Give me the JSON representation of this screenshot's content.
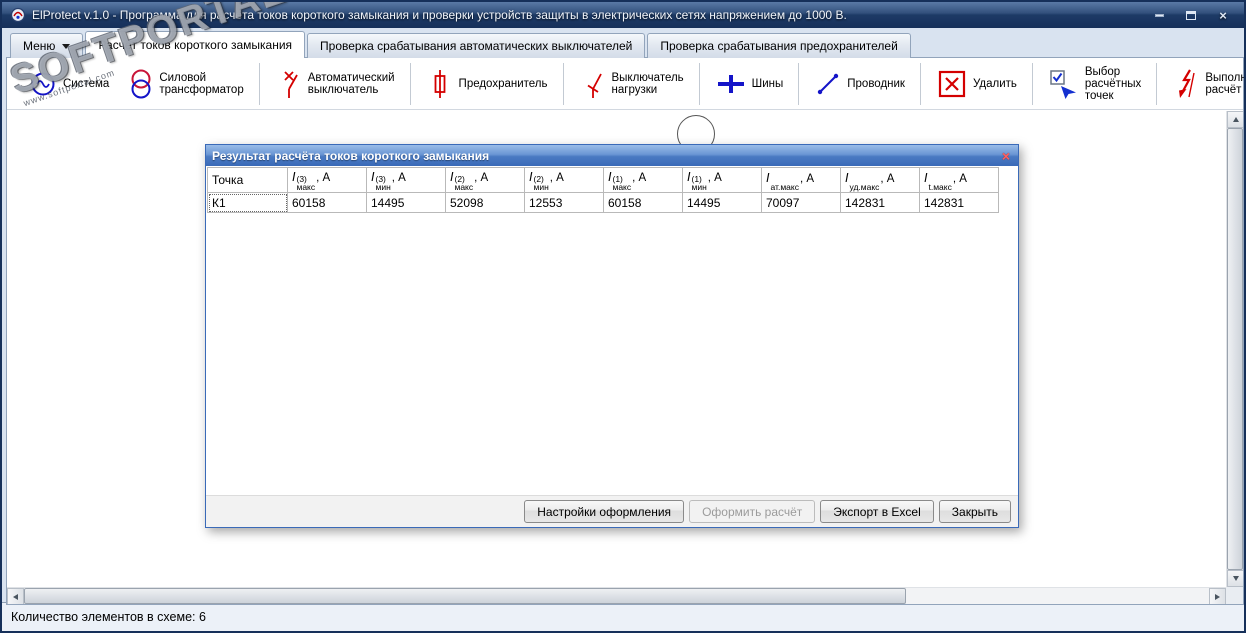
{
  "window": {
    "title": "ElProtect v.1.0 - Программа для расчёта токов короткого замыкания и проверки устройств защиты в электрических сетях напряжением до 1000 В.",
    "controls": [
      "minimize",
      "maximize",
      "close"
    ]
  },
  "watermark": {
    "title": "SOFTPORTAL",
    "subtitle": "www.softportal.com"
  },
  "menu": {
    "label": "Меню"
  },
  "tabs": [
    {
      "label": "Расчёт токов короткого замыкания",
      "active": true
    },
    {
      "label": "Проверка срабатывания автоматических выключателей",
      "active": false
    },
    {
      "label": "Проверка срабатывания предохранителей",
      "active": false
    }
  ],
  "toolbar": {
    "items": [
      {
        "label": "Система",
        "icon": "ac-source-icon"
      },
      {
        "label": "Силовой трансформатор",
        "icon": "transformer-icon"
      },
      {
        "label": "Автоматический выключатель",
        "icon": "circuit-breaker-icon"
      },
      {
        "label": "Предохранитель",
        "icon": "fuse-icon"
      },
      {
        "label": "Выключатель нагрузки",
        "icon": "load-switch-icon"
      },
      {
        "label": "Шины",
        "icon": "busbar-icon"
      },
      {
        "label": "Проводник",
        "icon": "conductor-icon"
      },
      {
        "label": "Удалить",
        "icon": "delete-icon"
      },
      {
        "label": "Выбор расчётных точек",
        "icon": "select-points-icon"
      },
      {
        "label": "Выполнить расчёт",
        "icon": "run-calculation-icon"
      }
    ]
  },
  "dialog": {
    "title": "Результат расчёта токов короткого замыкания",
    "close": "×",
    "table": {
      "columns": [
        {
          "text": "Точка"
        },
        {
          "base": "I",
          "sup": "(3)",
          "sub": "макс",
          "unit": ", А"
        },
        {
          "base": "I",
          "sup": "(3)",
          "sub": "мин",
          "unit": ", А"
        },
        {
          "base": "I",
          "sup": "(2)",
          "sub": "макс",
          "unit": ", А"
        },
        {
          "base": "I",
          "sup": "(2)",
          "sub": "мин",
          "unit": ", А"
        },
        {
          "base": "I",
          "sup": "(1)",
          "sub": "макс",
          "unit": ", А"
        },
        {
          "base": "I",
          "sup": "(1)",
          "sub": "мин",
          "unit": ", А"
        },
        {
          "base": "I",
          "sup": "",
          "sub": "ат.макс",
          "unit": ", А"
        },
        {
          "base": "I",
          "sup": "",
          "sub": "уд.макс",
          "unit": ", А"
        },
        {
          "base": "I",
          "sup": "",
          "sub": "t.макс",
          "unit": ", А"
        }
      ],
      "rows": [
        [
          "К1",
          "60158",
          "14495",
          "52098",
          "12553",
          "60158",
          "14495",
          "70097",
          "142831",
          "142831"
        ]
      ]
    },
    "buttons": [
      {
        "label": "Настройки оформления",
        "enabled": true
      },
      {
        "label": "Оформить расчёт",
        "enabled": false
      },
      {
        "label": "Экспорт в Excel",
        "enabled": true
      },
      {
        "label": "Закрыть",
        "enabled": true
      }
    ]
  },
  "status_bar": {
    "text": "Количество элементов в схеме: 6"
  },
  "colors": {
    "element_blue": "#1414c8",
    "element_red": "#d40000",
    "titlebar_blue": "#1b3a66",
    "dialog_title_blue": "#3a6ab8"
  }
}
